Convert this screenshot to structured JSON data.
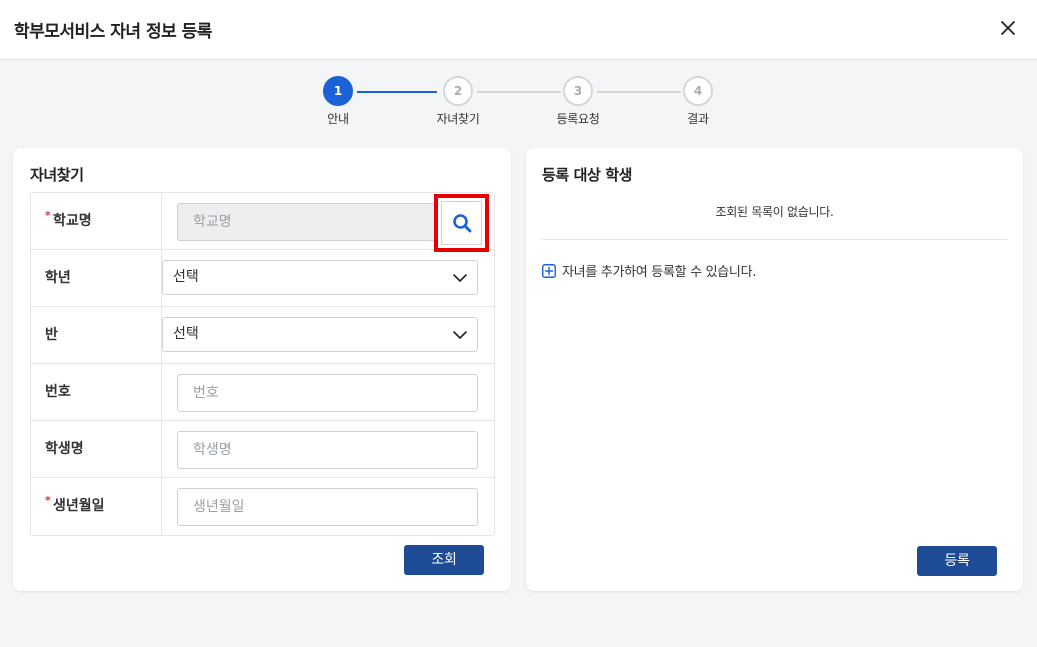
{
  "header": {
    "title": "학부모서비스 자녀 정보 등록"
  },
  "steps": [
    {
      "num": "1",
      "label": "안내"
    },
    {
      "num": "2",
      "label": "자녀찾기"
    },
    {
      "num": "3",
      "label": "등록요청"
    },
    {
      "num": "4",
      "label": "결과"
    }
  ],
  "left": {
    "title": "자녀찾기",
    "fields": {
      "school": {
        "label": "학교명",
        "placeholder": "학교명"
      },
      "grade": {
        "label": "학년",
        "value": "선택"
      },
      "class": {
        "label": "반",
        "value": "선택"
      },
      "number": {
        "label": "번호",
        "placeholder": "번호"
      },
      "name": {
        "label": "학생명",
        "placeholder": "학생명"
      },
      "birth": {
        "label": "생년월일",
        "placeholder": "생년월일"
      }
    },
    "required_mark": "*",
    "search_button": "조회"
  },
  "right": {
    "title": "등록 대상 학생",
    "empty_message": "조회된 목록이 없습니다.",
    "add_hint": "자녀를 추가하여 등록할 수 있습니다.",
    "register_button": "등록"
  },
  "icons": {
    "close": "close-icon",
    "search": "search-icon",
    "chevron": "chevron-down-icon",
    "plus": "plus-square-icon"
  },
  "colors": {
    "accent": "#1a62d6",
    "button": "#1e4b96",
    "required": "#e03131",
    "highlight": "#e60000"
  }
}
